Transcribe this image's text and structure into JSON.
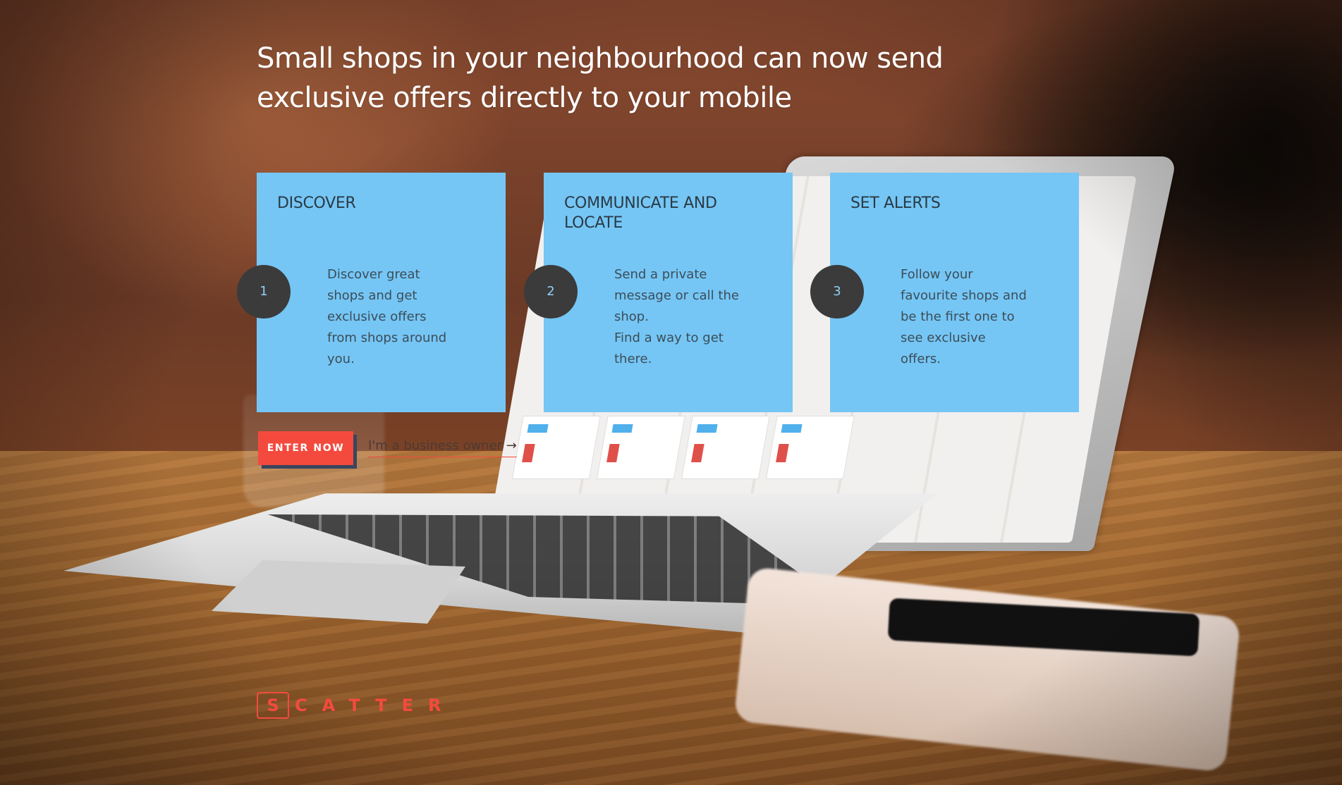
{
  "hero": {
    "headline": "Small shops in your neighbourhood can now send exclusive offers directly to your mobile"
  },
  "steps": [
    {
      "number": "1",
      "title": "DISCOVER",
      "text_lines": [
        "Discover great",
        "shops and get",
        "exclusive offers",
        "from shops around",
        "you."
      ]
    },
    {
      "number": "2",
      "title": "COMMUNICATE AND LOCATE",
      "text_lines": [
        "Send a private",
        "message or call the",
        "shop.",
        "Find a way to get",
        "there."
      ]
    },
    {
      "number": "3",
      "title": "SET ALERTS",
      "text_lines": [
        "Follow your",
        "favourite shops and",
        "be the first one to",
        "see exclusive offers."
      ]
    }
  ],
  "actions": {
    "enter_label": "ENTER NOW",
    "owner_link_label": "I'm a business owner →"
  },
  "logo": {
    "first_letter": "S",
    "rest": "CATTER"
  },
  "colors": {
    "card_bg": "#75c6f5",
    "accent": "#f44a3e",
    "button_shadow": "#39455e",
    "step_circle": "#3b3b3b"
  }
}
